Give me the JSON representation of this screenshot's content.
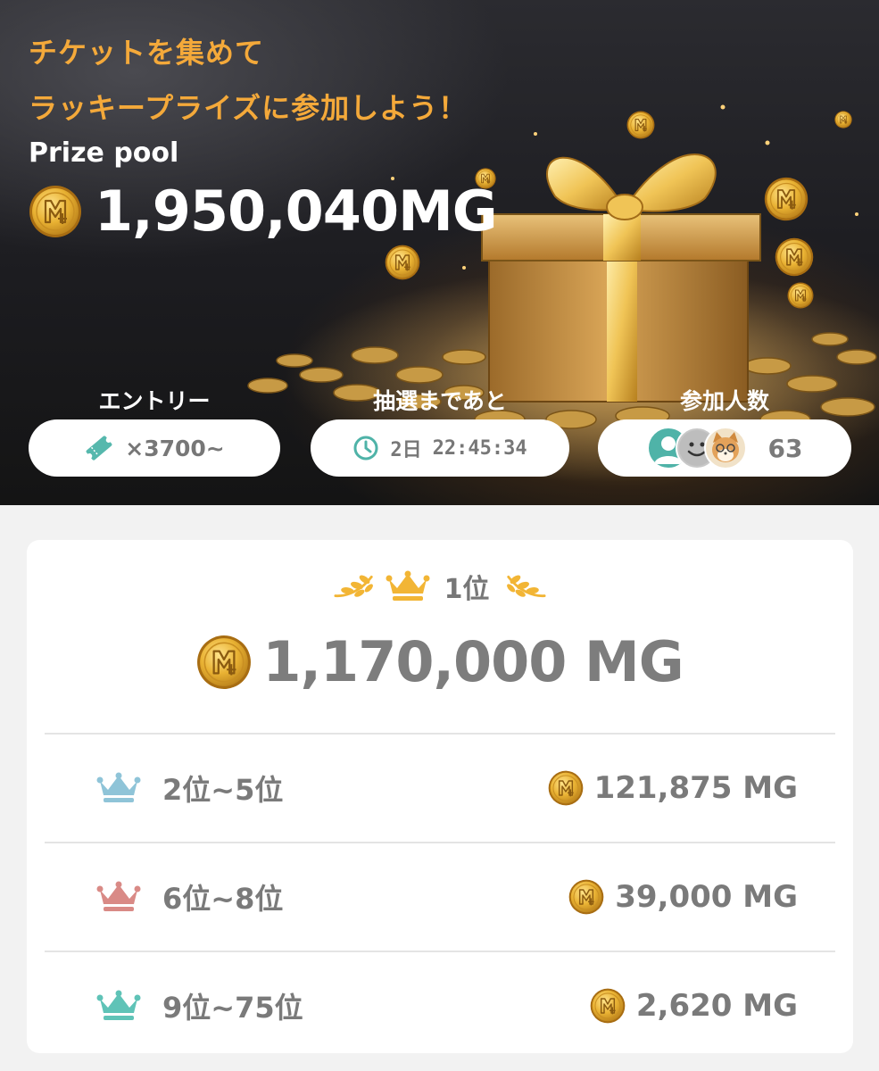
{
  "hero": {
    "headline_line1": "チケットを集めて",
    "headline_line2": "ラッキープライズに参加しよう！",
    "prize_pool_label": "Prize pool",
    "prize_pool_amount": "1,950,040MG",
    "coin_icon": "mg-coin-icon"
  },
  "stats": {
    "entry": {
      "label": "エントリー",
      "value": "×3700~",
      "icon": "ticket-icon"
    },
    "countdown": {
      "label": "抽選まであと",
      "days": "2日",
      "time": "22:45:34",
      "icon": "clock-icon"
    },
    "participants": {
      "label": "参加人数",
      "count": "63",
      "icons": [
        "avatar-teal",
        "avatar-smiley",
        "avatar-cat"
      ]
    }
  },
  "prizes": {
    "first": {
      "rank": "1位",
      "amount": "1,170,000 MG"
    },
    "tiers": [
      {
        "range": "2位~5位",
        "amount": "121,875 MG",
        "crown_color": "#8fc4d8"
      },
      {
        "range": "6位~8位",
        "amount": "39,000 MG",
        "crown_color": "#d98a86"
      },
      {
        "range": "9位~75位",
        "amount": "2,620 MG",
        "crown_color": "#5fc3b7"
      }
    ]
  },
  "colors": {
    "accent_gold": "#f4a93a",
    "crown_gold": "#f2b535",
    "teal": "#4fb3a8",
    "text_gray": "#7a7a7a"
  }
}
